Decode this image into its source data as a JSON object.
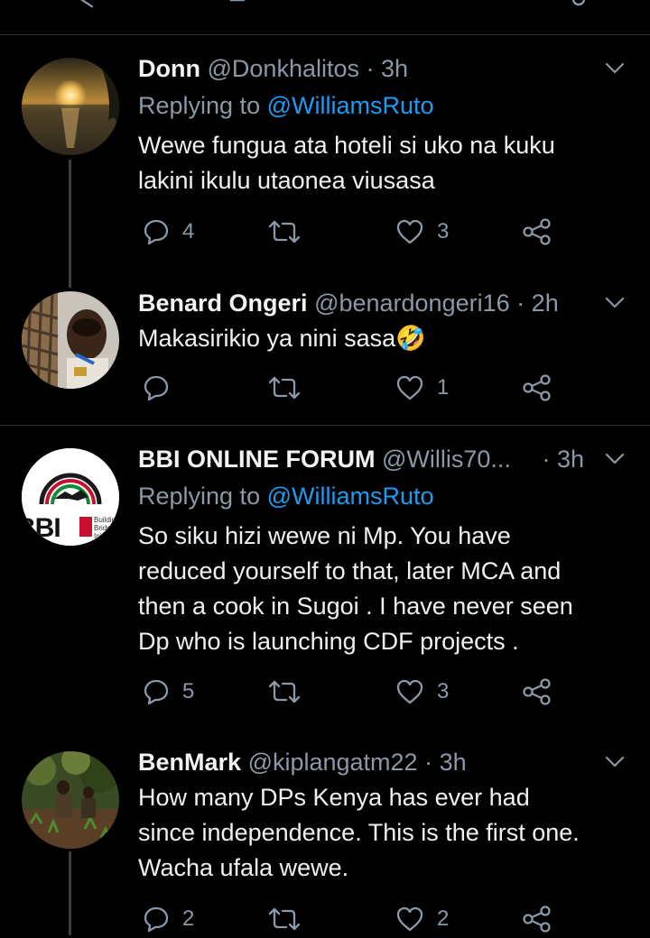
{
  "tweets": [
    {
      "name": "Donn",
      "handle": "@Donkhalitos",
      "sep": "·",
      "time": "3h",
      "replying_prefix": "Replying to",
      "replying_to": "@WilliamsRuto",
      "text_lines": [
        "Wewe fungua ata hoteli si uko na kuku",
        "lakini ikulu utaonea viusasa"
      ],
      "replies": "4",
      "retweets": "",
      "likes": "3"
    },
    {
      "name": "Benard Ongeri",
      "handle": "@benardongeri16",
      "sep": "·",
      "time": "2h",
      "text_lines": [
        "Makasirikio ya nini sasa🤣"
      ],
      "replies": "",
      "retweets": "",
      "likes": "1"
    },
    {
      "name": "BBI ONLINE FORUM",
      "handle": "@Willis70...",
      "sep": "·",
      "time": "3h",
      "replying_prefix": "Replying to",
      "replying_to": "@WilliamsRuto",
      "text_lines": [
        "So siku hizi wewe ni Mp. You have",
        "reduced yourself to that, later MCA and",
        "then a cook in Sugoi . I have never seen",
        "Dp who is launching CDF projects ."
      ],
      "replies": "5",
      "retweets": "",
      "likes": "3",
      "avatar_text": "BBI",
      "avatar_small_lines": [
        "Buildin",
        "Bridg",
        "Init"
      ]
    },
    {
      "name": "BenMark",
      "handle": "@kiplangatm22",
      "sep": "·",
      "time": "3h",
      "text_lines": [
        "How many DPs Kenya has ever had",
        "since independence. This is the first one.",
        "Wacha ufala wewe."
      ],
      "replies": "2",
      "retweets": "",
      "likes": "2"
    }
  ],
  "icons": {
    "reply": "reply-icon",
    "retweet": "retweet-icon",
    "like": "like-icon",
    "share": "share-icon",
    "more": "chevron-down-icon"
  },
  "colors": {
    "background": "#000000",
    "accent": "#1d9bf0",
    "muted": "#8b98a5",
    "separator": "#2f3336"
  }
}
